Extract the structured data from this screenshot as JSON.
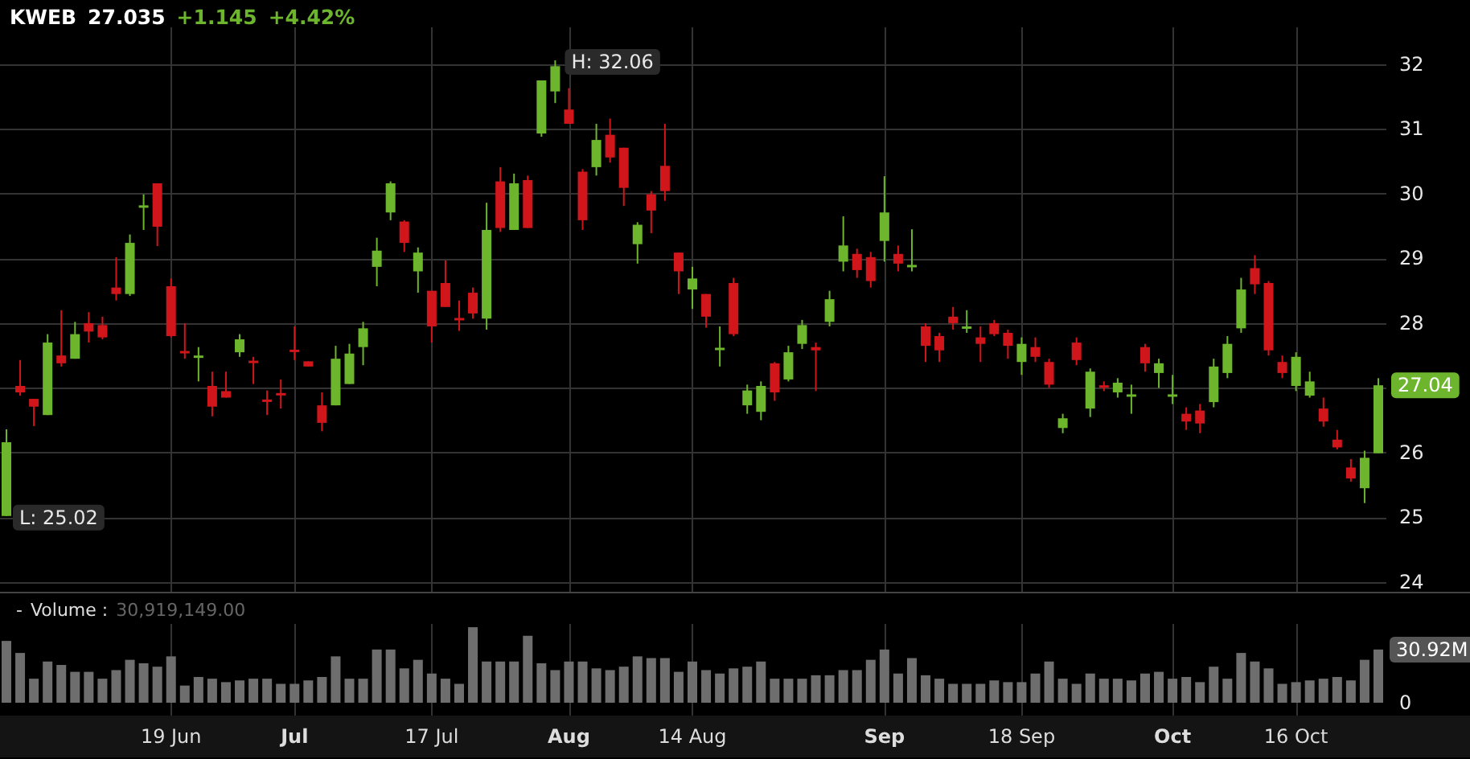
{
  "header": {
    "symbol": "KWEB",
    "price": "27.035",
    "change": "+1.145",
    "change_percent": "+4.42%"
  },
  "price_chart": {
    "chart_data": {
      "type": "candlestick",
      "grid": true,
      "ylim": [
        23.85,
        32.57
      ],
      "yticks": [
        24,
        25,
        26,
        28,
        29,
        30,
        31,
        32
      ],
      "categories": [
        null,
        null,
        null,
        null,
        null,
        null,
        null,
        null,
        null,
        null,
        null,
        null,
        "19 Jun",
        null,
        null,
        null,
        null,
        null,
        null,
        null,
        null,
        "Jul",
        null,
        null,
        null,
        null,
        null,
        null,
        null,
        null,
        null,
        "17 Jul",
        null,
        null,
        null,
        null,
        null,
        null,
        null,
        null,
        null,
        "Aug",
        null,
        null,
        null,
        null,
        null,
        null,
        null,
        null,
        "14 Aug",
        null,
        null,
        null,
        null,
        null,
        null,
        null,
        null,
        null,
        null,
        null,
        null,
        null,
        "Sep",
        null,
        null,
        null,
        null,
        null,
        null,
        null,
        null,
        null,
        "18 Sep",
        null,
        null,
        null,
        null,
        null,
        null,
        null,
        null,
        null,
        null,
        "Oct",
        null,
        null,
        null,
        null,
        null,
        null,
        null,
        null,
        "16 Oct",
        null,
        null,
        null,
        null,
        null,
        null
      ],
      "ohlc": [
        [
          25.02,
          26.36,
          25.02,
          26.16
        ],
        [
          27.03,
          27.43,
          26.88,
          26.93
        ],
        [
          26.83,
          26.83,
          26.41,
          26.71
        ],
        [
          26.58,
          27.83,
          26.58,
          27.7
        ],
        [
          27.5,
          28.2,
          27.33,
          27.38
        ],
        [
          27.45,
          28.02,
          27.45,
          27.83
        ],
        [
          28.0,
          28.17,
          27.7,
          27.87
        ],
        [
          27.97,
          28.1,
          27.75,
          27.78
        ],
        [
          28.55,
          29.02,
          28.35,
          28.45
        ],
        [
          28.45,
          29.37,
          28.42,
          29.24
        ],
        [
          29.8,
          29.99,
          29.44,
          29.82
        ],
        [
          30.16,
          30.16,
          29.19,
          29.49
        ],
        [
          28.57,
          28.69,
          27.78,
          27.8
        ],
        [
          27.57,
          28.0,
          27.45,
          27.55
        ],
        [
          27.47,
          27.63,
          27.1,
          27.5
        ],
        [
          27.03,
          27.25,
          26.56,
          26.71
        ],
        [
          26.95,
          27.25,
          26.85,
          26.85
        ],
        [
          27.55,
          27.83,
          27.48,
          27.75
        ],
        [
          27.42,
          27.48,
          27.06,
          27.4
        ],
        [
          26.82,
          26.96,
          26.58,
          26.8
        ],
        [
          26.92,
          27.13,
          26.68,
          26.9
        ],
        [
          27.59,
          27.95,
          27.43,
          27.57
        ],
        [
          27.41,
          27.41,
          27.33,
          27.33
        ],
        [
          26.73,
          26.93,
          26.33,
          26.46
        ],
        [
          26.73,
          27.65,
          26.73,
          27.45
        ],
        [
          27.06,
          27.68,
          27.06,
          27.53
        ],
        [
          27.63,
          28.02,
          27.35,
          27.92
        ],
        [
          28.87,
          29.32,
          28.57,
          29.12
        ],
        [
          29.71,
          30.19,
          29.59,
          30.16
        ],
        [
          29.57,
          29.59,
          29.1,
          29.24
        ],
        [
          28.8,
          29.17,
          28.47,
          29.09
        ],
        [
          28.5,
          28.5,
          27.7,
          27.95
        ],
        [
          28.62,
          28.97,
          28.25,
          28.25
        ],
        [
          28.08,
          28.35,
          27.88,
          28.07
        ],
        [
          28.47,
          28.55,
          28.07,
          28.15
        ],
        [
          28.07,
          29.86,
          27.9,
          29.44
        ],
        [
          30.19,
          30.41,
          29.41,
          29.47
        ],
        [
          29.44,
          30.31,
          29.44,
          30.16
        ],
        [
          30.21,
          30.28,
          29.47,
          29.47
        ],
        [
          30.93,
          31.75,
          30.88,
          31.75
        ],
        [
          31.58,
          32.06,
          31.4,
          31.97
        ],
        [
          31.3,
          31.63,
          31.08,
          31.08
        ],
        [
          30.34,
          30.38,
          29.44,
          29.59
        ],
        [
          30.41,
          31.08,
          30.28,
          30.83
        ],
        [
          30.91,
          31.16,
          30.48,
          30.56
        ],
        [
          30.71,
          30.71,
          29.81,
          30.09
        ],
        [
          29.22,
          29.56,
          28.92,
          29.52
        ],
        [
          29.99,
          30.04,
          29.39,
          29.74
        ],
        [
          30.43,
          31.08,
          29.89,
          30.04
        ],
        [
          29.09,
          29.09,
          28.45,
          28.8
        ],
        [
          28.52,
          28.87,
          28.22,
          28.69
        ],
        [
          28.45,
          28.45,
          27.93,
          28.1
        ],
        [
          27.6,
          27.95,
          27.33,
          27.62
        ],
        [
          28.62,
          28.7,
          27.8,
          27.83
        ],
        [
          26.73,
          27.05,
          26.6,
          26.96
        ],
        [
          26.63,
          27.1,
          26.5,
          27.03
        ],
        [
          27.38,
          27.4,
          26.8,
          26.93
        ],
        [
          27.13,
          27.65,
          27.1,
          27.55
        ],
        [
          27.68,
          28.05,
          27.6,
          27.97
        ],
        [
          27.63,
          27.7,
          26.95,
          27.58
        ],
        [
          28.02,
          28.5,
          27.95,
          28.37
        ],
        [
          28.95,
          29.65,
          28.8,
          29.2
        ],
        [
          29.07,
          29.15,
          28.7,
          28.82
        ],
        [
          29.02,
          29.1,
          28.55,
          28.65
        ],
        [
          29.27,
          30.27,
          28.95,
          29.71
        ],
        [
          29.07,
          29.2,
          28.8,
          28.92
        ],
        [
          28.88,
          29.45,
          28.8,
          28.9
        ],
        [
          27.95,
          28.0,
          27.4,
          27.65
        ],
        [
          27.8,
          27.85,
          27.4,
          27.58
        ],
        [
          28.1,
          28.25,
          27.9,
          28.0
        ],
        [
          27.93,
          28.2,
          27.85,
          27.95
        ],
        [
          27.78,
          27.95,
          27.4,
          27.68
        ],
        [
          28.0,
          28.05,
          27.8,
          27.83
        ],
        [
          27.85,
          27.9,
          27.45,
          27.65
        ],
        [
          27.4,
          27.78,
          27.2,
          27.68
        ],
        [
          27.63,
          27.78,
          27.4,
          27.48
        ],
        [
          27.4,
          27.45,
          27.0,
          27.05
        ],
        [
          26.38,
          26.6,
          26.3,
          26.53
        ],
        [
          27.7,
          27.78,
          27.35,
          27.43
        ],
        [
          26.68,
          27.3,
          26.55,
          27.25
        ],
        [
          27.04,
          27.1,
          26.95,
          27.02
        ],
        [
          26.93,
          27.15,
          26.85,
          27.08
        ],
        [
          26.88,
          27.05,
          26.6,
          26.9
        ],
        [
          27.63,
          27.68,
          27.25,
          27.38
        ],
        [
          27.23,
          27.45,
          27.0,
          27.38
        ],
        [
          26.88,
          27.2,
          26.75,
          26.9
        ],
        [
          26.6,
          26.7,
          26.35,
          26.48
        ],
        [
          26.65,
          26.75,
          26.3,
          26.45
        ],
        [
          26.78,
          27.45,
          26.7,
          27.33
        ],
        [
          27.23,
          27.8,
          27.15,
          27.68
        ],
        [
          27.92,
          28.7,
          27.85,
          28.52
        ],
        [
          28.85,
          29.05,
          28.45,
          28.6
        ],
        [
          28.62,
          28.65,
          27.5,
          27.58
        ],
        [
          27.4,
          27.5,
          27.15,
          27.23
        ],
        [
          27.03,
          27.55,
          26.95,
          27.48
        ],
        [
          26.88,
          27.25,
          26.85,
          27.1
        ],
        [
          26.68,
          26.85,
          26.4,
          26.48
        ],
        [
          26.2,
          26.35,
          26.05,
          26.08
        ],
        [
          25.77,
          25.9,
          25.55,
          25.6
        ],
        [
          25.45,
          26.03,
          25.22,
          25.92
        ],
        [
          25.99,
          27.15,
          25.99,
          27.04
        ]
      ]
    },
    "high_label": "H: 32.06",
    "low_label": "L: 25.02",
    "last_price_tag": "27.04"
  },
  "volume": {
    "collapse_symbol": "-",
    "label": "Volume :",
    "reading": "30,919,149.00",
    "current_tag": "30.92M",
    "axis_label": "0"
  }
}
